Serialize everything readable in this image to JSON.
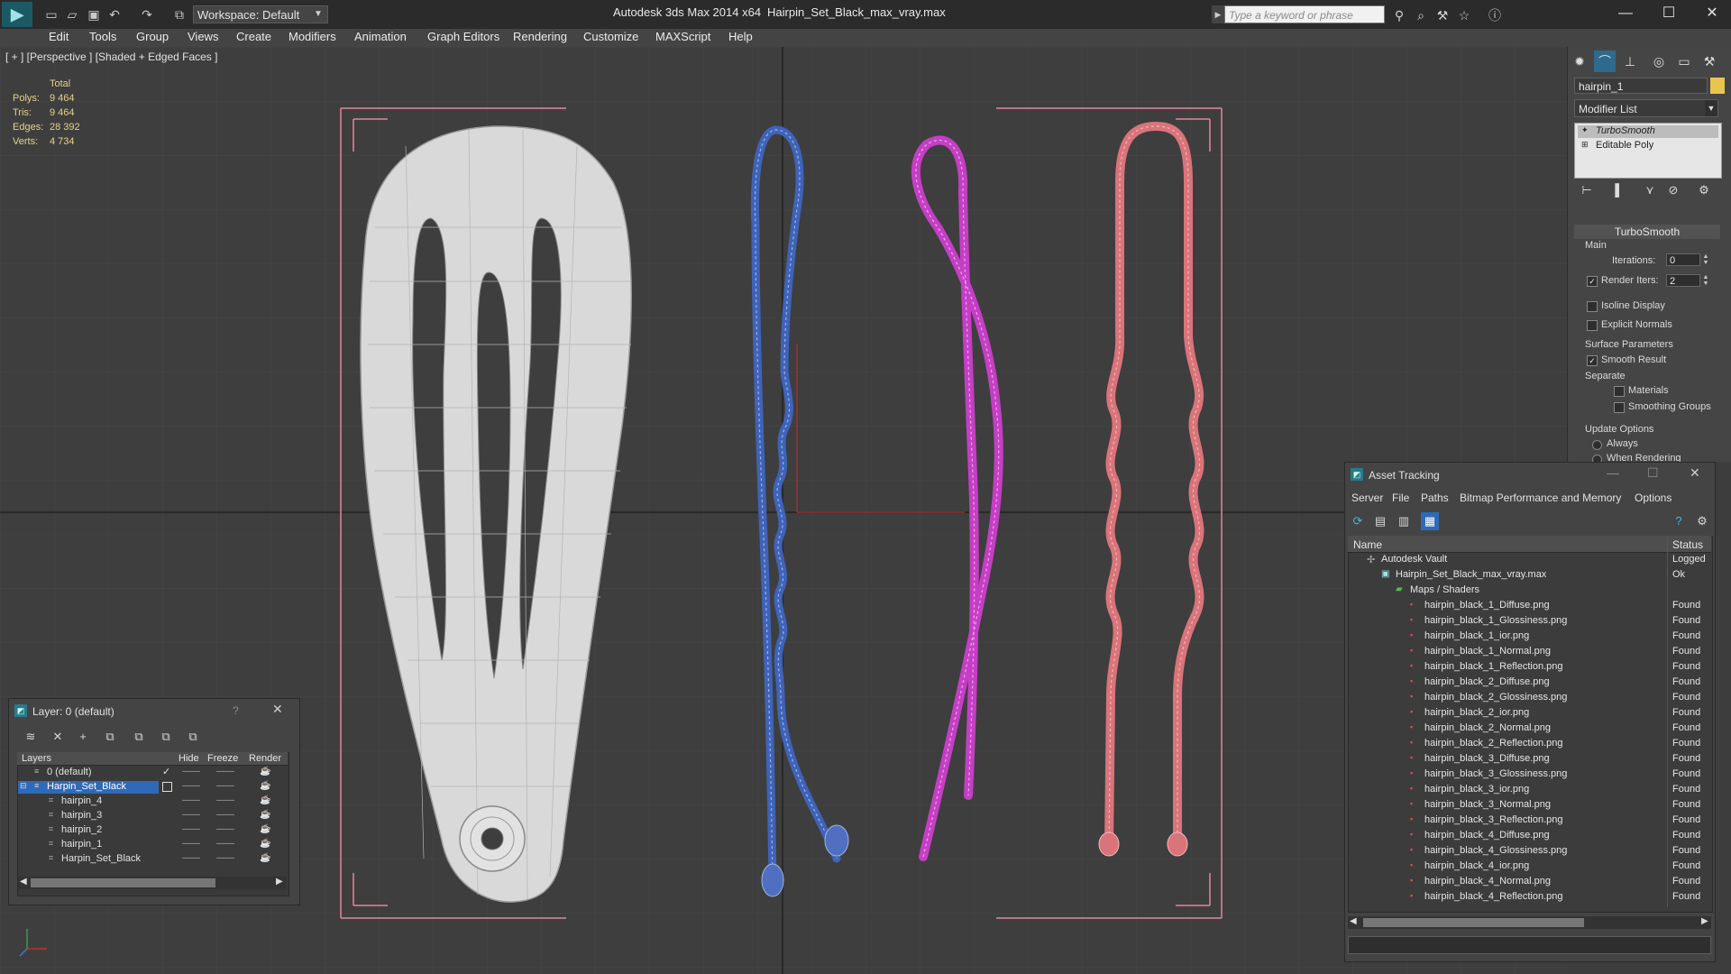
{
  "titlebar": {
    "workspace": "Workspace: Default",
    "app_title": "Autodesk 3ds Max  2014 x64",
    "file_title": "Hairpin_Set_Black_max_vray.max",
    "search_placeholder": "Type a keyword or phrase"
  },
  "menu": [
    "Edit",
    "Tools",
    "Group",
    "Views",
    "Create",
    "Modifiers",
    "Animation",
    "Graph Editors",
    "Rendering",
    "Customize",
    "MAXScript",
    "Help"
  ],
  "viewport": {
    "label": "[ + ] [Perspective ] [Shaded + Edged Faces ]",
    "stats": {
      "header": "Total",
      "rows": [
        {
          "label": "Polys:",
          "value": "9 464"
        },
        {
          "label": "Tris:",
          "value": "9 464"
        },
        {
          "label": "Edges:",
          "value": "28 392"
        },
        {
          "label": "Verts:",
          "value": "4 734"
        }
      ]
    },
    "colors": {
      "clip": "#c8c8c8",
      "blue_pin": "#3f63b8",
      "magenta_pin": "#c43fc4",
      "red_pin": "#d9747a",
      "bracket": "#e7839b"
    }
  },
  "command_panel": {
    "object_name": "hairpin_1",
    "modifier_list": "Modifier List",
    "stack": [
      "TurboSmooth",
      "Editable Poly"
    ],
    "rollout_title": "TurboSmooth",
    "main_label": "Main",
    "iterations_label": "Iterations:",
    "iterations_value": "0",
    "render_iters_label": "Render Iters:",
    "render_iters_value": "2",
    "isoline": "Isoline Display",
    "explicit_normals": "Explicit Normals",
    "surface_params": "Surface Parameters",
    "smooth_result": "Smooth Result",
    "separate": "Separate",
    "materials": "Materials",
    "smoothing_groups": "Smoothing Groups",
    "update_options": "Update Options",
    "always": "Always",
    "when_rendering": "When Rendering"
  },
  "layer_dialog": {
    "title": "Layer: 0 (default)",
    "help": "?",
    "headers": {
      "layers": "Layers",
      "hide": "Hide",
      "freeze": "Freeze",
      "render": "Render"
    },
    "rows": [
      {
        "name": "0 (default)",
        "selected": false
      },
      {
        "name": "Harpin_Set_Black",
        "selected": true
      },
      {
        "name": "hairpin_4",
        "selected": false
      },
      {
        "name": "hairpin_3",
        "selected": false
      },
      {
        "name": "hairpin_2",
        "selected": false
      },
      {
        "name": "hairpin_1",
        "selected": false
      },
      {
        "name": "Harpin_Set_Black",
        "selected": false
      }
    ],
    "dash": "——"
  },
  "asset_tracking": {
    "title": "Asset Tracking",
    "menu": [
      "Server",
      "File",
      "Paths",
      "Bitmap Performance and Memory",
      "Options"
    ],
    "headers": {
      "name": "Name",
      "status": "Status"
    },
    "vault": {
      "name": "Autodesk Vault",
      "status": "Logged"
    },
    "file": {
      "name": "Hairpin_Set_Black_max_vray.max",
      "status": "Ok"
    },
    "maps_folder": "Maps / Shaders",
    "maps": [
      {
        "name": "hairpin_black_1_Diffuse.png",
        "status": "Found"
      },
      {
        "name": "hairpin_black_1_Glossiness.png",
        "status": "Found"
      },
      {
        "name": "hairpin_black_1_ior.png",
        "status": "Found"
      },
      {
        "name": "hairpin_black_1_Normal.png",
        "status": "Found"
      },
      {
        "name": "hairpin_black_1_Reflection.png",
        "status": "Found"
      },
      {
        "name": "hairpin_black_2_Diffuse.png",
        "status": "Found"
      },
      {
        "name": "hairpin_black_2_Glossiness.png",
        "status": "Found"
      },
      {
        "name": "hairpin_black_2_ior.png",
        "status": "Found"
      },
      {
        "name": "hairpin_black_2_Normal.png",
        "status": "Found"
      },
      {
        "name": "hairpin_black_2_Reflection.png",
        "status": "Found"
      },
      {
        "name": "hairpin_black_3_Diffuse.png",
        "status": "Found"
      },
      {
        "name": "hairpin_black_3_Glossiness.png",
        "status": "Found"
      },
      {
        "name": "hairpin_black_3_ior.png",
        "status": "Found"
      },
      {
        "name": "hairpin_black_3_Normal.png",
        "status": "Found"
      },
      {
        "name": "hairpin_black_3_Reflection.png",
        "status": "Found"
      },
      {
        "name": "hairpin_black_4_Diffuse.png",
        "status": "Found"
      },
      {
        "name": "hairpin_black_4_Glossiness.png",
        "status": "Found"
      },
      {
        "name": "hairpin_black_4_ior.png",
        "status": "Found"
      },
      {
        "name": "hairpin_black_4_Normal.png",
        "status": "Found"
      },
      {
        "name": "hairpin_black_4_Reflection.png",
        "status": "Found"
      }
    ]
  }
}
